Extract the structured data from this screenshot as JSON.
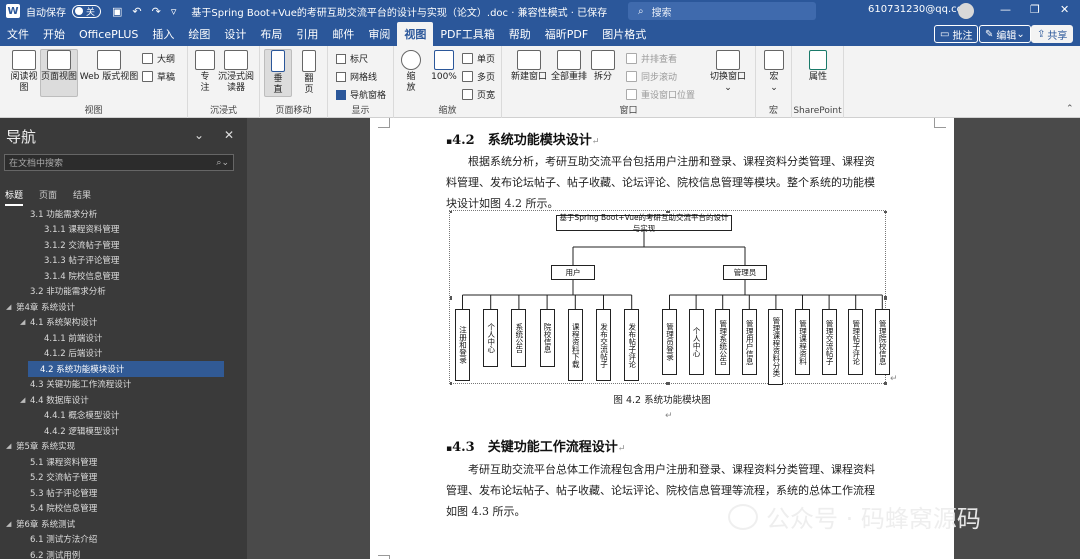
{
  "titlebar": {
    "app_icon": "W",
    "autosave_label": "自动保存",
    "autosave_state": "关",
    "save_icon": "save-icon",
    "undo_icon": "undo-icon",
    "redo_icon": "redo-icon",
    "title": "基于Spring Boot+Vue的考研互助交流平台的设计与实现（论文）.doc · 兼容性模式 · 已保存",
    "search_placeholder": "搜索",
    "account": "610731230@qq.com"
  },
  "menu": {
    "tabs": [
      "文件",
      "开始",
      "OfficePLUS",
      "插入",
      "绘图",
      "设计",
      "布局",
      "引用",
      "邮件",
      "审阅",
      "视图",
      "PDF工具箱",
      "帮助",
      "福昕PDF",
      "图片格式"
    ],
    "active": "视图",
    "comment": "批注",
    "edit": "编辑",
    "share": "共享"
  },
  "ribbon": {
    "views": {
      "read": "阅读视图",
      "print": "页面视图",
      "web": "Web 版式视图",
      "outline": "大纲",
      "draft": "草稿",
      "label": "视图"
    },
    "immersive": {
      "focus": "专注",
      "reader": "沉浸式阅读器",
      "label": "沉浸式"
    },
    "page_move": {
      "vertical": "垂直",
      "side": "翻页",
      "label": "页面移动"
    },
    "show": {
      "ruler": "标尺",
      "gridlines": "网格线",
      "nav_pane": "导航窗格",
      "label": "显示"
    },
    "zoom": {
      "zoom": "缩放",
      "pct": "100%",
      "one": "单页",
      "multi": "多页",
      "width": "页宽",
      "label": "缩放"
    },
    "window": {
      "new": "新建窗口",
      "arrange": "全部重排",
      "split": "拆分",
      "side_by_side": "并排查看",
      "sync_scroll": "同步滚动",
      "reset": "重设窗口位置",
      "switch": "切换窗口",
      "label": "窗口"
    },
    "macro": {
      "btn": "宏",
      "label": "宏"
    },
    "sharepoint": {
      "btn": "属性",
      "label": "SharePoint"
    }
  },
  "nav": {
    "title": "导航",
    "search_placeholder": "在文档中搜索",
    "tabs": [
      "标题",
      "页面",
      "结果"
    ],
    "items": [
      {
        "text": "3.1 功能需求分析",
        "level": 2,
        "ar": ""
      },
      {
        "text": "3.1.1 课程资料管理",
        "level": 3,
        "ar": ""
      },
      {
        "text": "3.1.2 交流帖子管理",
        "level": 3,
        "ar": ""
      },
      {
        "text": "3.1.3 帖子评论管理",
        "level": 3,
        "ar": ""
      },
      {
        "text": "3.1.4 院校信息管理",
        "level": 3,
        "ar": ""
      },
      {
        "text": "3.2 非功能需求分析",
        "level": 2,
        "ar": ""
      },
      {
        "text": "第4章 系统设计",
        "level": 1,
        "ar": "◢"
      },
      {
        "text": "4.1 系统架构设计",
        "level": 2,
        "ar": "◢"
      },
      {
        "text": "4.1.1 前端设计",
        "level": 3,
        "ar": ""
      },
      {
        "text": "4.1.2 后端设计",
        "level": 3,
        "ar": ""
      },
      {
        "text": "4.2 系统功能模块设计",
        "level": 2,
        "ar": "",
        "selected": true
      },
      {
        "text": "4.3 关键功能工作流程设计",
        "level": 2,
        "ar": ""
      },
      {
        "text": "4.4 数据库设计",
        "level": 2,
        "ar": "◢"
      },
      {
        "text": "4.4.1 概念模型设计",
        "level": 3,
        "ar": ""
      },
      {
        "text": "4.4.2 逻辑模型设计",
        "level": 3,
        "ar": ""
      },
      {
        "text": "第5章 系统实现",
        "level": 1,
        "ar": "◢"
      },
      {
        "text": "5.1 课程资料管理",
        "level": 2,
        "ar": ""
      },
      {
        "text": "5.2 交流帖子管理",
        "level": 2,
        "ar": ""
      },
      {
        "text": "5.3 帖子评论管理",
        "level": 2,
        "ar": ""
      },
      {
        "text": "5.4 院校信息管理",
        "level": 2,
        "ar": ""
      },
      {
        "text": "第6章 系统测试",
        "level": 1,
        "ar": "◢"
      },
      {
        "text": "6.1 测试方法介绍",
        "level": 2,
        "ar": ""
      },
      {
        "text": "6.2 测试用例",
        "level": 2,
        "ar": ""
      }
    ]
  },
  "doc": {
    "h42": "4.2　系统功能模块设计",
    "p1": "根据系统分析，考研互助交流平台包括用户注册和登录、课程资料分类管理、课程资料管理、发布论坛帖子、帖子收藏、论坛评论、院校信息管理等模块。整个系统的功能模块设计如图 4.2 所示。",
    "figure": {
      "root": "基于Spring Boot+Vue的考研互助交流平台的设计与实现",
      "user": "用户",
      "admin": "管理员",
      "user_leaves": [
        "注册和登录",
        "个人中心",
        "系统公告",
        "院校信息",
        "课程资料下载",
        "发布交流帖子",
        "发布帖子评论"
      ],
      "admin_leaves": [
        "管理员登录",
        "个人中心",
        "管理系统公告",
        "管理用户信息",
        "管理课程资料分类",
        "管理课程资料",
        "管理交流帖子",
        "管理帖子评论",
        "管理院校信息"
      ]
    },
    "caption": "图 4.2  系统功能模块图",
    "h43": "4.3　关键功能工作流程设计",
    "p2": "考研互助交流平台总体工作流程包含用户注册和登录、课程资料分类管理、课程资料管理、发布论坛帖子、帖子收藏、论坛评论、院校信息管理等流程，系统的总体工作流程如图 4.3 所示。"
  },
  "watermark": "公众号 · 码蜂窝源码"
}
